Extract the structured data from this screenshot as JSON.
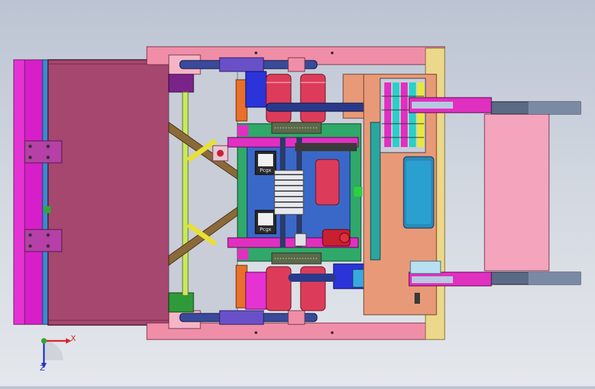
{
  "triad": {
    "x_label": "X",
    "z_label": "Z",
    "x_color": "#d8262a",
    "y_color": "#2fa635",
    "z_color": "#2438c8"
  },
  "pcb_labels": {
    "upper": "Pcgx",
    "lower": "Pcgx"
  },
  "colors": {
    "frame": "#f08ea8",
    "blade": "#a84a72",
    "magenta": "#e428c8",
    "blue_plate": "#3a68c8",
    "green_plate": "#2fa86a",
    "cylinder_red": "#dc3c5a",
    "orange_panel": "#e89a78",
    "handle": "#f4a4bc",
    "steel": "#5a6a84"
  }
}
